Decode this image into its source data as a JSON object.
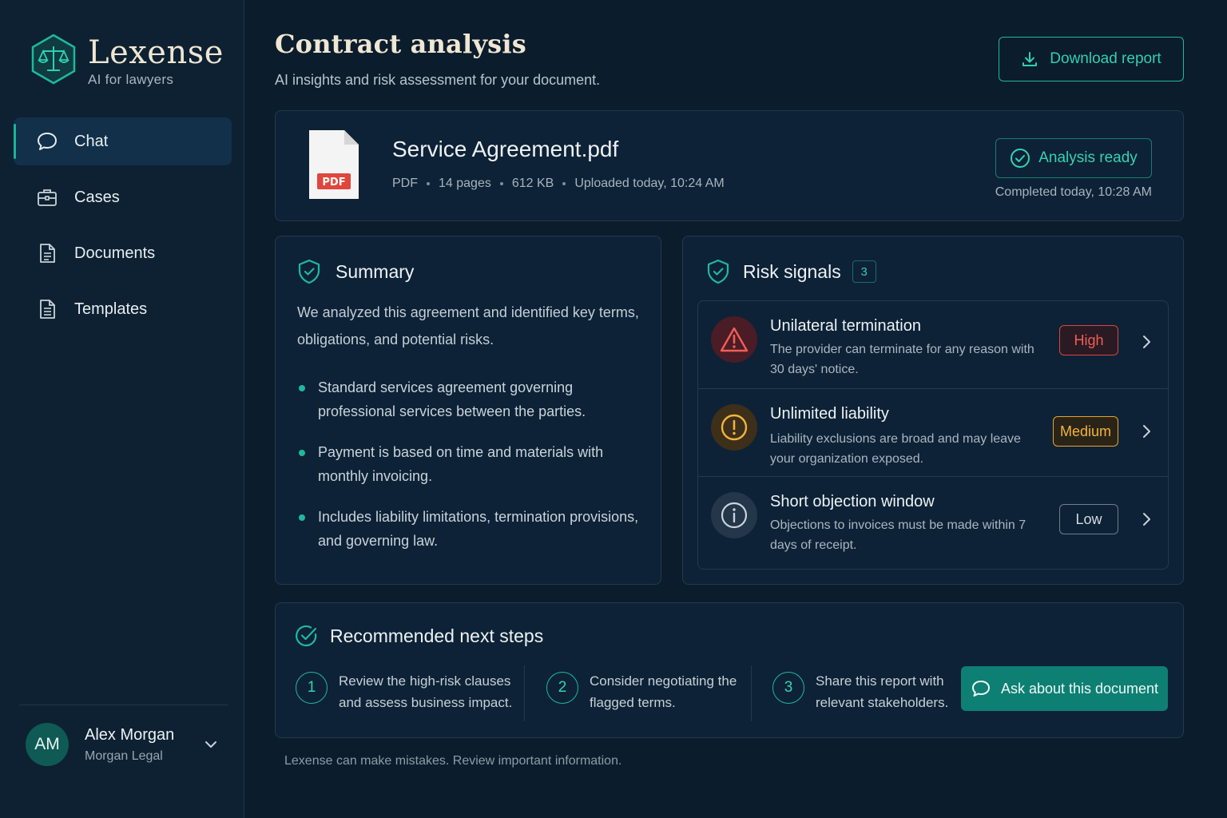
{
  "brand": {
    "name": "Lexense",
    "tagline": "AI for lawyers"
  },
  "nav": {
    "items": [
      {
        "label": "Chat",
        "icon": "chat-bubble-icon",
        "active": true
      },
      {
        "label": "Cases",
        "icon": "briefcase-icon",
        "active": false
      },
      {
        "label": "Documents",
        "icon": "document-icon",
        "active": false
      },
      {
        "label": "Templates",
        "icon": "template-icon",
        "active": false
      }
    ]
  },
  "user": {
    "initials": "AM",
    "name": "Alex Morgan",
    "org": "Morgan Legal"
  },
  "header": {
    "title": "Contract analysis",
    "subtitle": "AI insights and risk assessment for your document.",
    "download_label": "Download report"
  },
  "file": {
    "name": "Service Agreement.pdf",
    "icon_label": "PDF",
    "type": "PDF",
    "pages": "14 pages",
    "size": "612 KB",
    "uploaded": "Uploaded today, 10:24 AM",
    "status": "Analysis ready",
    "completed": "Completed today, 10:28 AM"
  },
  "summary": {
    "title": "Summary",
    "intro": "We analyzed this agreement and identified key terms, obligations, and potential risks.",
    "points": [
      "Standard services agreement governing professional services between the parties.",
      "Payment is based on time and materials with monthly invoicing.",
      "Includes liability limitations, termination provisions, and governing law."
    ]
  },
  "risks": {
    "title": "Risk signals",
    "count": "3",
    "items": [
      {
        "title": "Unilateral termination",
        "desc": "The provider can terminate for any reason with 30 days' notice.",
        "severity": "High",
        "icon": "warning-triangle-icon"
      },
      {
        "title": "Unlimited liability",
        "desc": "Liability exclusions are broad and may leave your organization exposed.",
        "severity": "Medium",
        "icon": "alert-circle-icon"
      },
      {
        "title": "Short objection window",
        "desc": "Objections to invoices must be made within 7 days of receipt.",
        "severity": "Low",
        "icon": "info-circle-icon"
      }
    ]
  },
  "steps": {
    "title": "Recommended next steps",
    "items": [
      {
        "num": "1",
        "text": "Review the high-risk clauses and assess business impact."
      },
      {
        "num": "2",
        "text": "Consider negotiating the flagged terms."
      },
      {
        "num": "3",
        "text": "Share this report with relevant stakeholders."
      }
    ],
    "ask_label": "Ask about this document"
  },
  "disclaimer": "Lexense can make mistakes. Review important information.",
  "colors": {
    "accent": "#1fb89e",
    "high": "#f05f55",
    "medium": "#f2b43c",
    "low": "#d3dbe2"
  }
}
